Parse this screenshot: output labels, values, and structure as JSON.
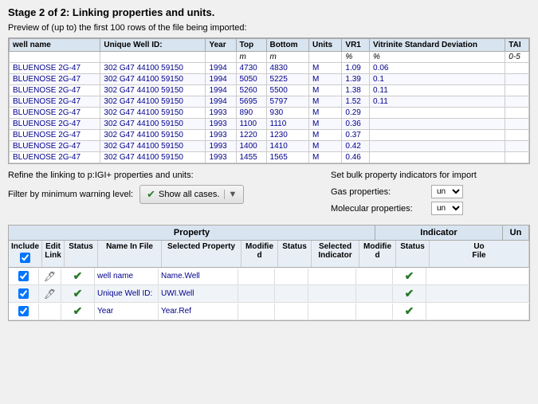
{
  "title": "Stage 2 of 2: Linking properties and units.",
  "subtitle": "Preview of (up to) the first 100 rows of the file being imported:",
  "table": {
    "columns": [
      "well name",
      "Unique Well ID:",
      "Year",
      "Top",
      "Bottom",
      "Units",
      "VR1",
      "Vitrinite Standard Deviation",
      "TAI"
    ],
    "units_row": [
      "",
      "",
      "",
      "m",
      "m",
      "",
      "%",
      "%",
      "0-5"
    ],
    "rows": [
      [
        "BLUENOSE 2G-47",
        "302 G47 44100 59150",
        "1994",
        "4730",
        "4830",
        "M",
        "1.09",
        "0.06",
        ""
      ],
      [
        "BLUENOSE 2G-47",
        "302 G47 44100 59150",
        "1994",
        "5050",
        "5225",
        "M",
        "1.39",
        "0.1",
        ""
      ],
      [
        "BLUENOSE 2G-47",
        "302 G47 44100 59150",
        "1994",
        "5260",
        "5500",
        "M",
        "1.38",
        "0.11",
        ""
      ],
      [
        "BLUENOSE 2G-47",
        "302 G47 44100 59150",
        "1994",
        "5695",
        "5797",
        "M",
        "1.52",
        "0.11",
        ""
      ],
      [
        "BLUENOSE 2G-47",
        "302 G47 44100 59150",
        "1993",
        "890",
        "930",
        "M",
        "0.29",
        "",
        ""
      ],
      [
        "BLUENOSE 2G-47",
        "302 G47 44100 59150",
        "1993",
        "1100",
        "1110",
        "M",
        "0.36",
        "",
        ""
      ],
      [
        "BLUENOSE 2G-47",
        "302 G47 44100 59150",
        "1993",
        "1220",
        "1230",
        "M",
        "0.37",
        "",
        ""
      ],
      [
        "BLUENOSE 2G-47",
        "302 G47 44100 59150",
        "1993",
        "1400",
        "1410",
        "M",
        "0.42",
        "",
        ""
      ],
      [
        "BLUENOSE 2G-47",
        "302 G47 44100 59150",
        "1993",
        "1455",
        "1565",
        "M",
        "0.46",
        "",
        ""
      ]
    ]
  },
  "refine_label": "Refine the linking to p:IGI+ properties and units:",
  "filter_label": "Filter by minimum warning level:",
  "show_cases_label": "Show all cases.",
  "bulk_label": "Set bulk property indicators for import",
  "gas_label": "Gas properties:",
  "gas_value": "un",
  "molecular_label": "Molecular properties:",
  "molecular_value": "un",
  "bottom_table": {
    "section_headers": [
      "Property",
      "Indicator",
      "Un"
    ],
    "col_headers_property": [
      "Include",
      "Edit\nLink",
      "Status",
      "Name In File",
      "Selected Property",
      "Modifie\nd"
    ],
    "col_headers_indicator": [
      "Status",
      "Selected\nIndicator",
      "Modifie\nd"
    ],
    "col_headers_unit": [
      "Status",
      "Uo\nFile"
    ],
    "rows": [
      {
        "include": true,
        "edit": true,
        "status": "check",
        "name": "well name",
        "selected_property": "Name.Well",
        "modified": "",
        "ind_status": "",
        "ind_selected": "",
        "ind_modified": "",
        "unit_status": "check",
        "unit_file": ""
      },
      {
        "include": true,
        "edit": true,
        "status": "check",
        "name": "Unique Well ID:",
        "selected_property": "UWI.Well",
        "modified": "",
        "ind_status": "",
        "ind_selected": "",
        "ind_modified": "",
        "unit_status": "check",
        "unit_file": ""
      },
      {
        "include": true,
        "edit": false,
        "status": "check",
        "name": "Year",
        "selected_property": "Year.Ref",
        "modified": "",
        "ind_status": "",
        "ind_selected": "",
        "ind_modified": "",
        "unit_status": "check",
        "unit_file": ""
      }
    ]
  },
  "include_label": "Include",
  "edit_label": "Edit\nLink",
  "selected_property_label": "Selected Property",
  "units_col_label": "Units"
}
